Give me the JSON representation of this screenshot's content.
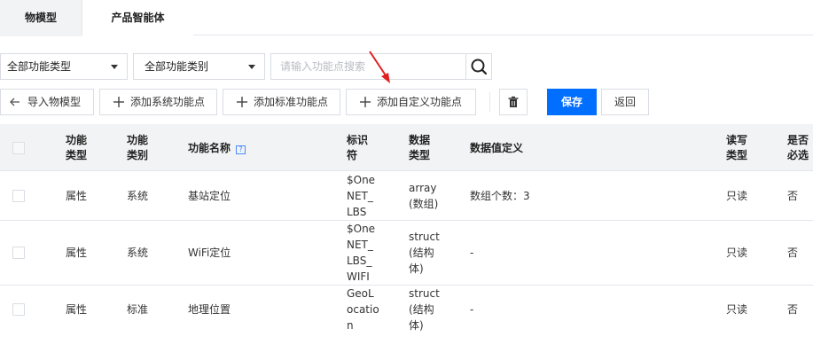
{
  "tabs": [
    {
      "label": "物模型",
      "active": true
    },
    {
      "label": "产品智能体",
      "active": false
    }
  ],
  "filters": {
    "function_type": "全部功能类型",
    "function_category": "全部功能类别",
    "search_placeholder": "请输入功能点搜索"
  },
  "toolbar": {
    "import_label": "导入物模型",
    "add_system_label": "添加系统功能点",
    "add_standard_label": "添加标准功能点",
    "add_custom_label": "添加自定义功能点",
    "save_label": "保存",
    "back_label": "返回"
  },
  "table": {
    "headers": {
      "func_type": [
        "功能",
        "类型"
      ],
      "func_category": [
        "功能",
        "类别"
      ],
      "func_name": "功能名称",
      "identifier": [
        "标识",
        "符"
      ],
      "data_type": [
        "数据",
        "类型"
      ],
      "data_def": "数据值定义",
      "rw": [
        "读写",
        "类型"
      ],
      "required": [
        "是否",
        "必选"
      ]
    },
    "rows": [
      {
        "func_type": "属性",
        "func_category": "系统",
        "func_name": "基站定位",
        "identifier": [
          "$One",
          "NET_",
          "LBS"
        ],
        "data_type": [
          "array",
          "(数组)"
        ],
        "data_def": "数组个数：3",
        "rw": "只读",
        "required": "否"
      },
      {
        "func_type": "属性",
        "func_category": "系统",
        "func_name": "WiFi定位",
        "identifier": [
          "$One",
          "NET_",
          "LBS_",
          "WIFI"
        ],
        "data_type": [
          "struct",
          "(结构",
          "体)"
        ],
        "data_def": "-",
        "rw": "只读",
        "required": "否"
      },
      {
        "func_type": "属性",
        "func_category": "标准",
        "func_name": "地理位置",
        "identifier": [
          "GeoL",
          "ocatio",
          "n"
        ],
        "data_type": [
          "struct",
          "(结构",
          "体)"
        ],
        "data_def": "-",
        "rw": "只读",
        "required": "否"
      }
    ]
  },
  "colors": {
    "primary": "#006eff",
    "annotation_arrow": "#e02020",
    "header_bg": "#f2f3f5",
    "border": "#e3e6eb"
  }
}
